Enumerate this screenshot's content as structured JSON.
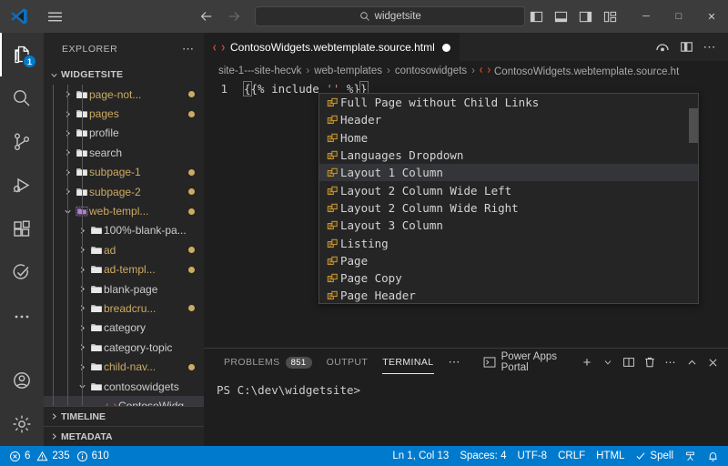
{
  "titlebar": {
    "logo_icon": "vscode-logo-icon",
    "menu_icon": "hamburger-menu-icon",
    "back_icon": "arrow-left-icon",
    "forward_icon": "arrow-right-icon",
    "search_icon": "search-icon",
    "search_value": "widgetsite",
    "layout_icons": [
      {
        "name": "toggle-primary-sidebar-icon"
      },
      {
        "name": "toggle-panel-icon"
      },
      {
        "name": "toggle-secondary-sidebar-icon"
      },
      {
        "name": "customize-layout-icon"
      }
    ],
    "window_controls": [
      {
        "name": "minimize-button",
        "glyph": "─"
      },
      {
        "name": "maximize-button",
        "glyph": "□"
      },
      {
        "name": "close-button",
        "glyph": "✕"
      }
    ]
  },
  "activitybar": {
    "items": [
      {
        "name": "explorer",
        "icon": "files-icon",
        "active": true,
        "badge": "1"
      },
      {
        "name": "search",
        "icon": "search-icon",
        "active": false,
        "badge": ""
      },
      {
        "name": "source-control",
        "icon": "source-control-icon",
        "active": false,
        "badge": ""
      },
      {
        "name": "run-and-debug",
        "icon": "run-debug-icon",
        "active": false,
        "badge": ""
      },
      {
        "name": "extensions",
        "icon": "extensions-icon",
        "active": false,
        "badge": ""
      },
      {
        "name": "testing",
        "icon": "testing-icon",
        "active": false,
        "badge": ""
      },
      {
        "name": "additional-views",
        "icon": "ellipsis-icon",
        "active": false,
        "badge": ""
      }
    ],
    "bottom_items": [
      {
        "name": "accounts",
        "icon": "account-icon"
      },
      {
        "name": "manage-settings",
        "icon": "gear-icon"
      }
    ]
  },
  "sidebar": {
    "title": "EXPLORER",
    "more_actions_icon": "ellipsis-icon",
    "root_folder": "WIDGETSITE",
    "tree": [
      {
        "label": "page-not...",
        "indent": 1,
        "type": "folder",
        "expanded": false,
        "modified": true
      },
      {
        "label": "pages",
        "indent": 1,
        "type": "folder",
        "expanded": false,
        "modified": true
      },
      {
        "label": "profile",
        "indent": 1,
        "type": "folder",
        "expanded": false,
        "modified": false
      },
      {
        "label": "search",
        "indent": 1,
        "type": "folder",
        "expanded": false,
        "modified": false
      },
      {
        "label": "subpage-1",
        "indent": 1,
        "type": "folder",
        "expanded": false,
        "modified": true
      },
      {
        "label": "subpage-2",
        "indent": 1,
        "type": "folder",
        "expanded": false,
        "modified": true
      },
      {
        "label": "web-templ...",
        "indent": 1,
        "type": "folder-open-highlight",
        "expanded": true,
        "modified": true
      },
      {
        "label": "100%-blank-pa...",
        "indent": 2,
        "type": "folder",
        "expanded": false,
        "modified": false
      },
      {
        "label": "ad",
        "indent": 2,
        "type": "folder",
        "expanded": false,
        "modified": true
      },
      {
        "label": "ad-templ...",
        "indent": 2,
        "type": "folder",
        "expanded": false,
        "modified": true
      },
      {
        "label": "blank-page",
        "indent": 2,
        "type": "folder",
        "expanded": false,
        "modified": false
      },
      {
        "label": "breadcru...",
        "indent": 2,
        "type": "folder",
        "expanded": false,
        "modified": true
      },
      {
        "label": "category",
        "indent": 2,
        "type": "folder",
        "expanded": false,
        "modified": false
      },
      {
        "label": "category-topic",
        "indent": 2,
        "type": "folder",
        "expanded": false,
        "modified": false
      },
      {
        "label": "child-nav...",
        "indent": 2,
        "type": "folder",
        "expanded": false,
        "modified": true
      },
      {
        "label": "contosowidgets",
        "indent": 2,
        "type": "folder",
        "expanded": true,
        "modified": false
      },
      {
        "label": "ContosoWidg...",
        "indent": 3,
        "type": "html-file",
        "expanded": false,
        "modified": false,
        "selected": true
      }
    ],
    "bottom_sections": [
      {
        "label": "TIMELINE",
        "expanded": false
      },
      {
        "label": "METADATA",
        "expanded": false
      }
    ]
  },
  "editor": {
    "tab": {
      "icon": "html-file-icon",
      "name": "ContosoWidgets.webtemplate.source.html",
      "dirty": true
    },
    "tab_actions": [
      {
        "name": "open-preview-icon"
      },
      {
        "name": "split-editor-icon"
      },
      {
        "name": "more-actions-icon"
      }
    ],
    "breadcrumbs": [
      {
        "label": "site-1---site-hecvk",
        "icon": ""
      },
      {
        "label": "web-templates",
        "icon": ""
      },
      {
        "label": "contosowidgets",
        "icon": ""
      },
      {
        "label": "ContosoWidgets.webtemplate.source.ht",
        "icon": "html-file-icon"
      }
    ],
    "breadcrumb_separator": "›",
    "line_number": "1",
    "code_prefix": "{% include ",
    "code_string": "''",
    "code_suffix": " %}"
  },
  "suggest": {
    "selected_index": 4,
    "items": [
      {
        "label": "Full Page without Child Links",
        "icon": "snippet-icon"
      },
      {
        "label": "Header",
        "icon": "snippet-icon"
      },
      {
        "label": "Home",
        "icon": "snippet-icon"
      },
      {
        "label": "Languages Dropdown",
        "icon": "snippet-icon"
      },
      {
        "label": "Layout 1 Column",
        "icon": "snippet-icon"
      },
      {
        "label": "Layout 2 Column Wide Left",
        "icon": "snippet-icon"
      },
      {
        "label": "Layout 2 Column Wide Right",
        "icon": "snippet-icon"
      },
      {
        "label": "Layout 3 Column",
        "icon": "snippet-icon"
      },
      {
        "label": "Listing",
        "icon": "snippet-icon"
      },
      {
        "label": "Page",
        "icon": "snippet-icon"
      },
      {
        "label": "Page Copy",
        "icon": "snippet-icon"
      },
      {
        "label": "Page Header",
        "icon": "snippet-icon"
      }
    ]
  },
  "panel": {
    "tabs": [
      {
        "label": "PROBLEMS",
        "badge": "851",
        "active": false
      },
      {
        "label": "OUTPUT",
        "badge": "",
        "active": false
      },
      {
        "label": "TERMINAL",
        "badge": "",
        "active": true
      }
    ],
    "more_tabs_icon": "ellipsis-icon",
    "terminal_profile": "Power Apps Portal",
    "terminal_profile_icon": "terminal-icon",
    "actions": [
      {
        "name": "new-terminal-icon",
        "glyph": "+"
      },
      {
        "name": "terminal-profile-dropdown-icon",
        "glyph": "∨"
      },
      {
        "name": "split-terminal-icon",
        "glyph": ""
      },
      {
        "name": "kill-terminal-icon",
        "glyph": ""
      },
      {
        "name": "panel-more-actions-icon",
        "glyph": "…"
      },
      {
        "name": "maximize-panel-icon",
        "glyph": "⌃"
      },
      {
        "name": "close-panel-icon",
        "glyph": "✕"
      }
    ],
    "prompt": "PS C:\\dev\\widgetsite>"
  },
  "statusbar": {
    "errors_icon": "error-icon",
    "errors": "6",
    "warnings_icon": "warning-icon",
    "warnings": "235",
    "info_icon": "info-icon",
    "info": "610",
    "cursor_position": "Ln 1, Col 13",
    "indentation": "Spaces: 4",
    "encoding": "UTF-8",
    "eol": "CRLF",
    "language": "HTML",
    "spell_icon": "check-icon",
    "spell": "Spell",
    "remote_icon": "remote-indicator-icon",
    "bell_icon": "notifications-bell-icon"
  },
  "colors": {
    "accent": "#007acc",
    "titlebar_bg": "#3c3c3c",
    "sidebar_bg": "#252526",
    "editor_bg": "#1e1e1e",
    "activitybar_bg": "#333333",
    "modified_folder": "#cdab61",
    "html_icon": "#e44d26",
    "selection_bg": "#37373d"
  }
}
